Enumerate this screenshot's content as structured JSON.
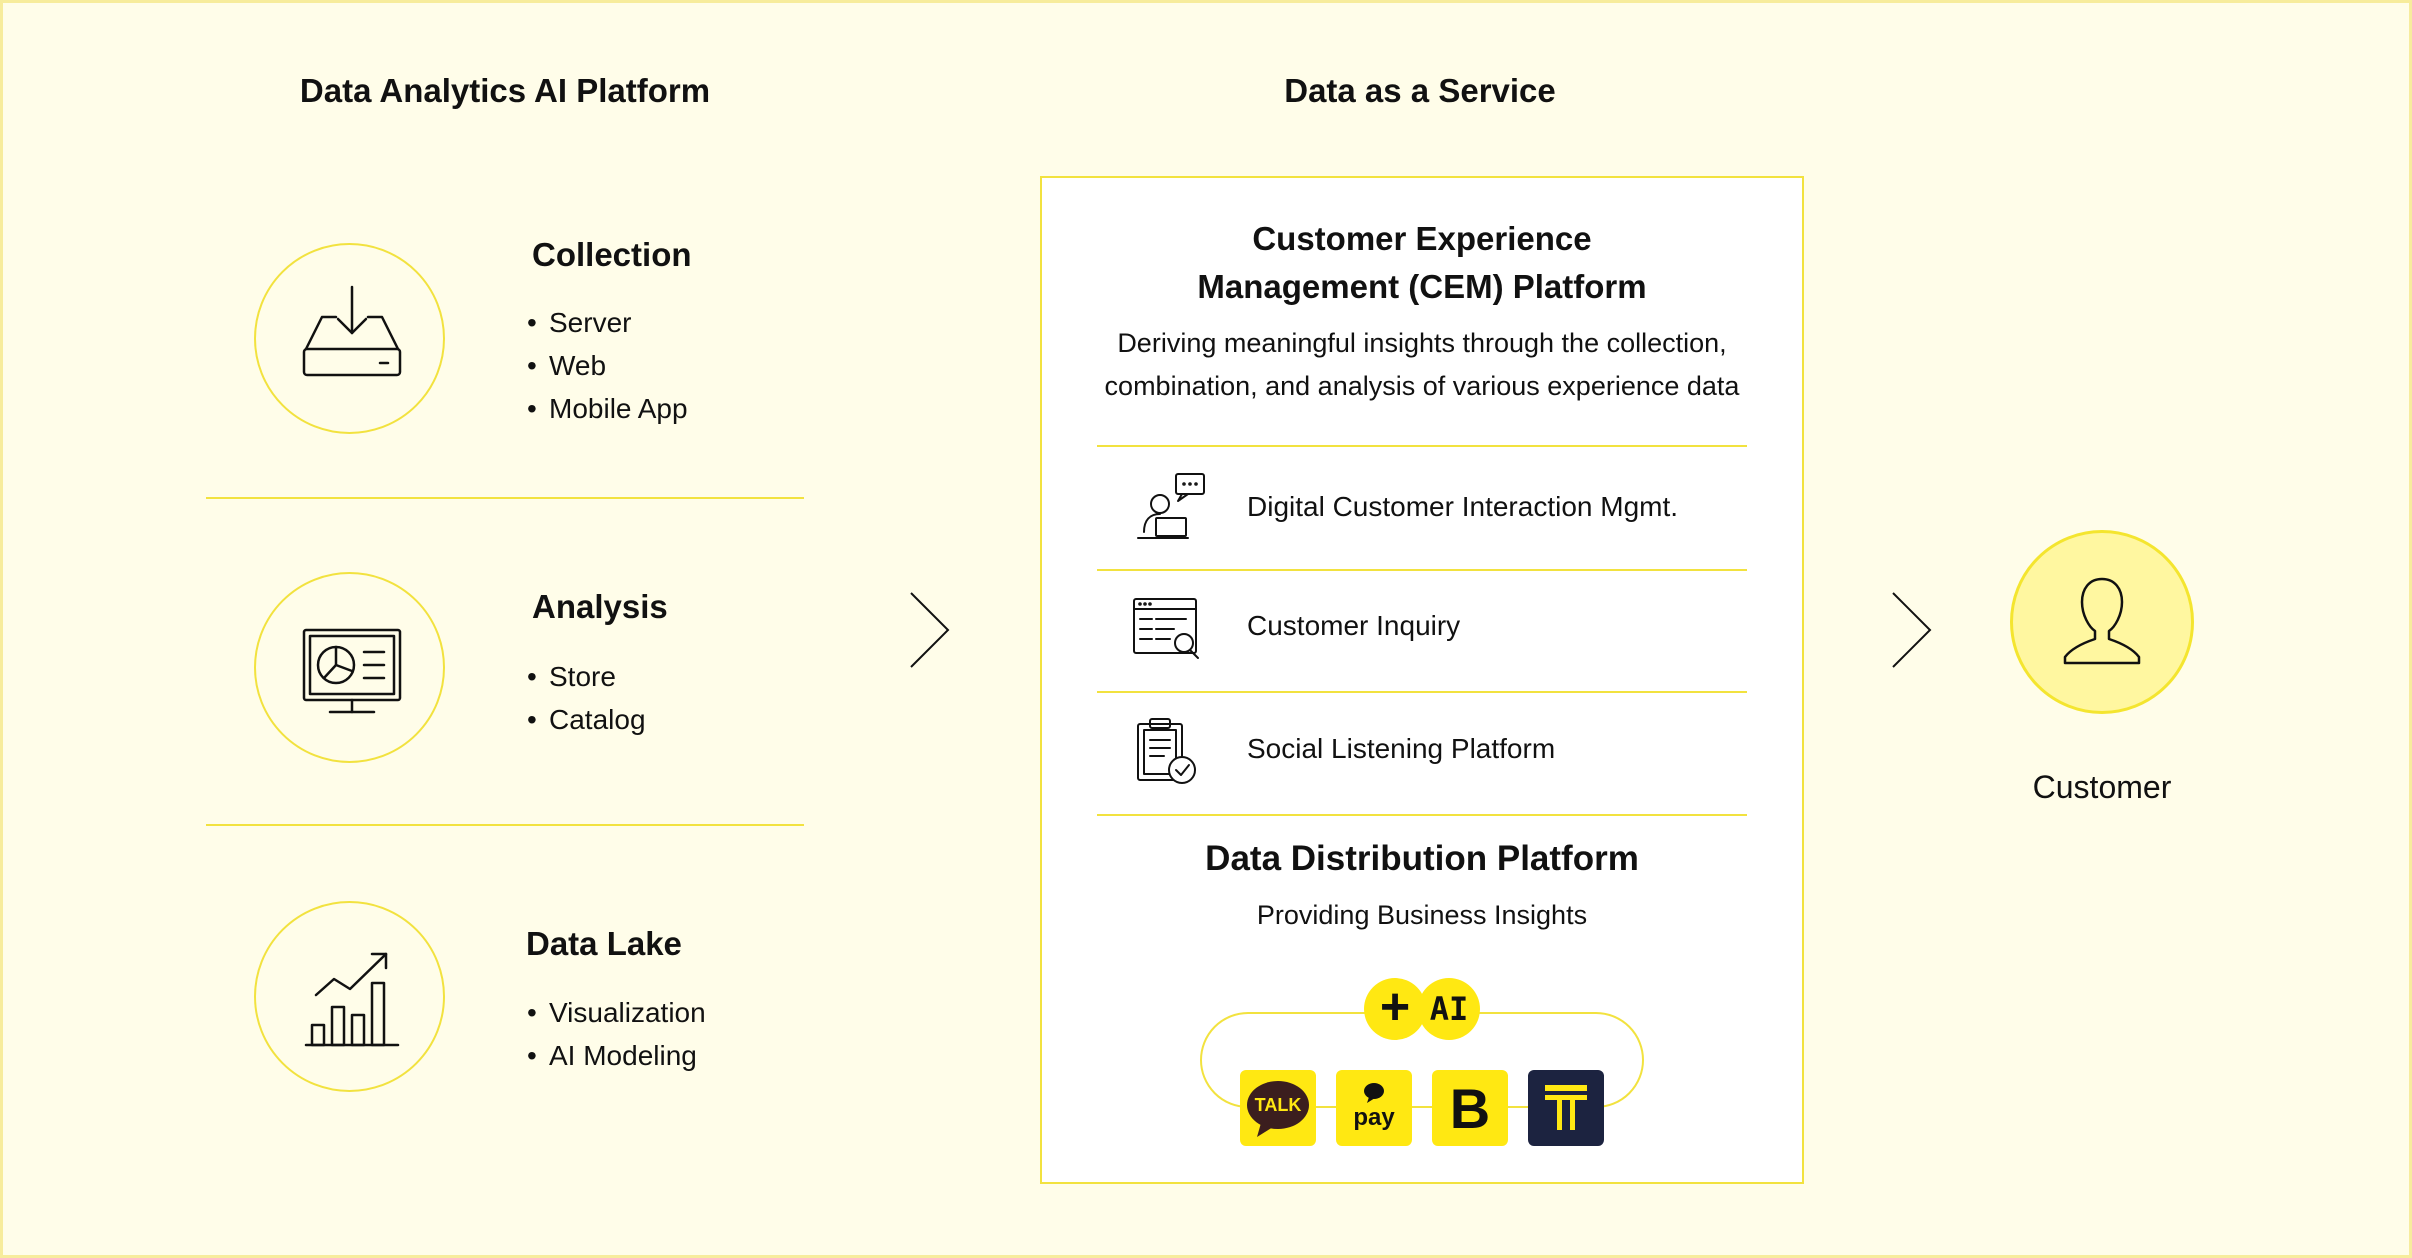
{
  "left": {
    "title": "Data Analytics AI Platform",
    "sections": [
      {
        "title": "Collection",
        "icon": "download-server-icon",
        "items": [
          "Server",
          "Web",
          "Mobile App"
        ]
      },
      {
        "title": "Analysis",
        "icon": "monitor-pie-chart-icon",
        "items": [
          "Store",
          "Catalog"
        ]
      },
      {
        "title": "Data Lake",
        "icon": "bar-chart-trend-icon",
        "items": [
          "Visualization",
          "AI Modeling"
        ]
      }
    ]
  },
  "center": {
    "title": "Data as a Service",
    "cem": {
      "title_line1": "Customer Experience",
      "title_line2": "Management (CEM) Platform",
      "desc_line1": "Deriving meaningful insights through the collection,",
      "desc_line2": "combination, and analysis of various experience data",
      "rows": [
        {
          "label": "Digital Customer Interaction Mgmt.",
          "icon": "person-laptop-chat-icon"
        },
        {
          "label": "Customer Inquiry",
          "icon": "form-search-icon"
        },
        {
          "label": "Social Listening Platform",
          "icon": "clipboard-check-icon"
        }
      ]
    },
    "distribution": {
      "title": "Data Distribution Platform",
      "subtitle": "Providing Business Insights",
      "badge_plus": "+",
      "badge_ai": "AI",
      "apps": [
        {
          "name": "kakaotalk-icon",
          "label": "TALK",
          "bg": "#ffe812"
        },
        {
          "name": "kakaopay-icon",
          "label": "pay",
          "bg": "#ffe812"
        },
        {
          "name": "kakaobank-icon",
          "label": "B",
          "bg": "#ffe812"
        },
        {
          "name": "kakaot-icon",
          "label": "T",
          "bg": "#1c2340"
        }
      ]
    }
  },
  "right": {
    "label": "Customer",
    "icon": "user-icon"
  },
  "colors": {
    "background": "#fffde9",
    "accent": "#f2e23f",
    "highlight": "#ffe812",
    "customer_fill": "#fff7a0"
  }
}
